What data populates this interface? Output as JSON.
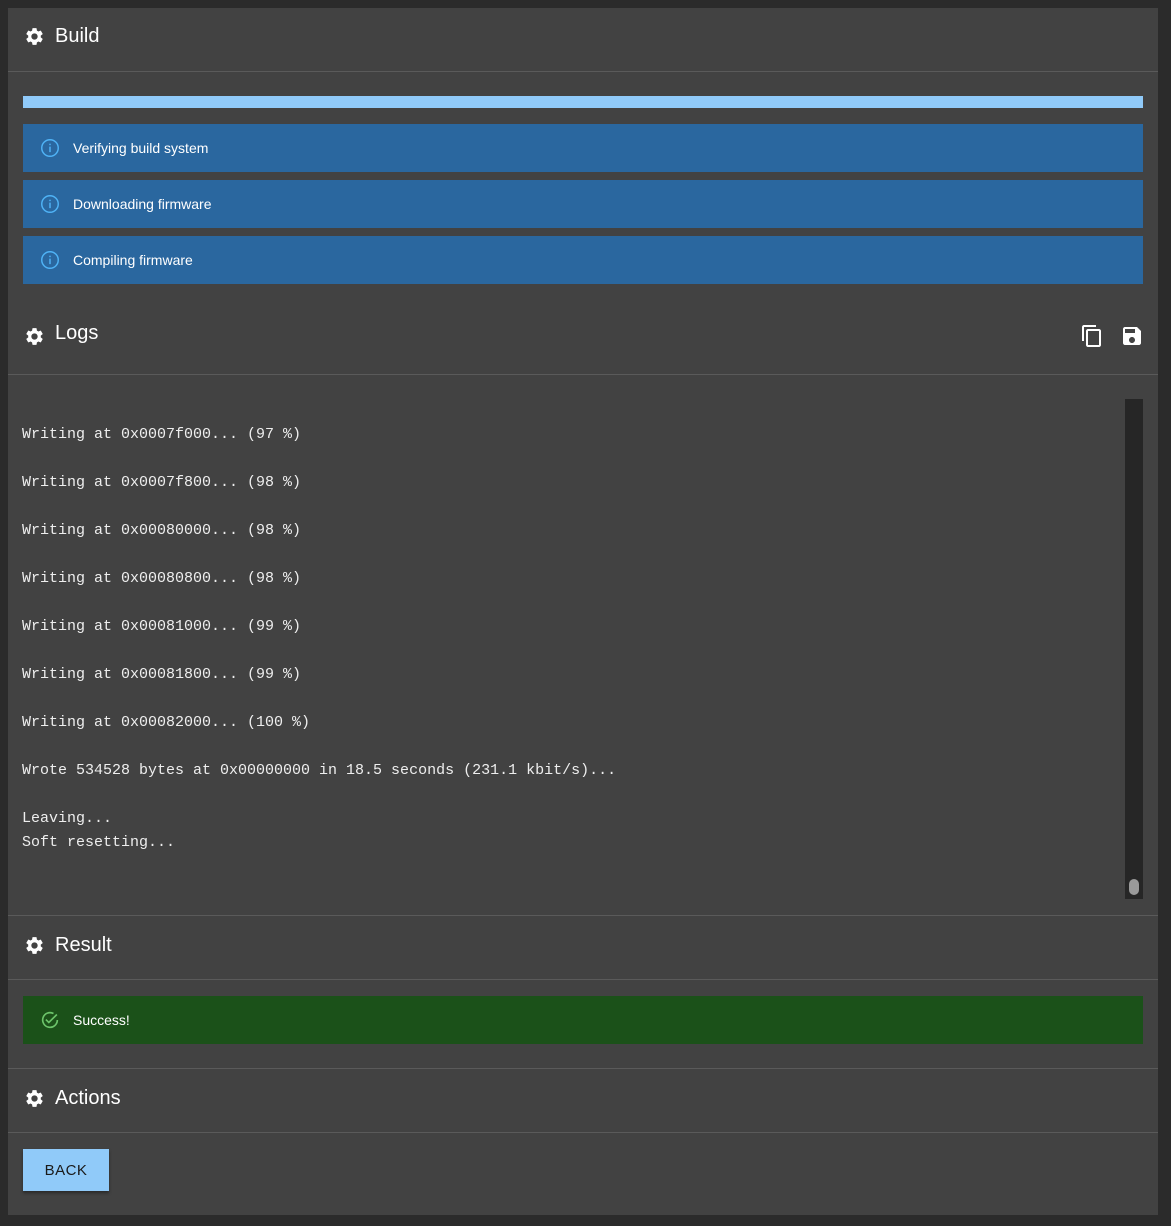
{
  "build": {
    "title": "Build",
    "icon": "gear-icon",
    "progress": 1.0,
    "steps": [
      {
        "label": "Verifying build system",
        "icon": "info-icon"
      },
      {
        "label": "Downloading firmware",
        "icon": "info-icon"
      },
      {
        "label": "Compiling firmware",
        "icon": "info-icon"
      }
    ]
  },
  "logs": {
    "title": "Logs",
    "icon": "gear-icon",
    "actions": [
      {
        "name": "copy",
        "icon": "copy-icon"
      },
      {
        "name": "save",
        "icon": "save-icon"
      }
    ],
    "lines": [
      "",
      "Writing at 0x0007f000... (97 %)",
      "",
      "Writing at 0x0007f800... (98 %)",
      "",
      "Writing at 0x00080000... (98 %)",
      "",
      "Writing at 0x00080800... (98 %)",
      "",
      "Writing at 0x00081000... (99 %)",
      "",
      "Writing at 0x00081800... (99 %)",
      "",
      "Writing at 0x00082000... (100 %)",
      "",
      "Wrote 534528 bytes at 0x00000000 in 18.5 seconds (231.1 kbit/s)...",
      "",
      "Leaving...",
      "Soft resetting..."
    ]
  },
  "result": {
    "title": "Result",
    "icon": "gear-icon",
    "message": "Success!",
    "message_icon": "check-circle-icon"
  },
  "actions": {
    "title": "Actions",
    "icon": "gear-icon",
    "back_label": "BACK"
  },
  "colors": {
    "panel": "#424242",
    "info": "#2a679f",
    "success": "#1b5119",
    "accent": "#90caf9"
  }
}
